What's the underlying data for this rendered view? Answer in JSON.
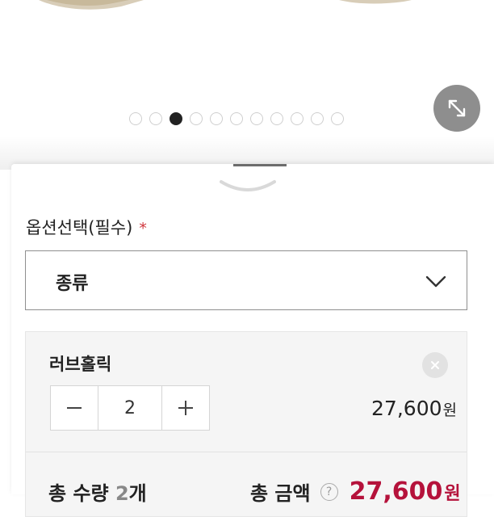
{
  "carousel": {
    "total_slides": 11,
    "active_index": 2
  },
  "options": {
    "label": "옵션선택(필수)",
    "required_mark": "*",
    "select_value": "종류"
  },
  "item": {
    "name": "러브홀릭",
    "quantity": "2",
    "price": "27,600",
    "price_unit": "원"
  },
  "summary": {
    "qty_label": "총 수량",
    "qty_value": "2",
    "qty_unit": "개",
    "amount_label": "총 금액",
    "help_glyph": "?",
    "amount_value": "27,600",
    "amount_unit": "원"
  },
  "icons": {
    "expand": "expand-arrows-icon",
    "chevron": "chevron-down-icon",
    "remove": "close-icon",
    "minus": "minus-icon",
    "plus": "plus-icon"
  },
  "colors": {
    "accent_price": "#b5123b",
    "required": "#d0353b",
    "active_dot": "#222222"
  }
}
